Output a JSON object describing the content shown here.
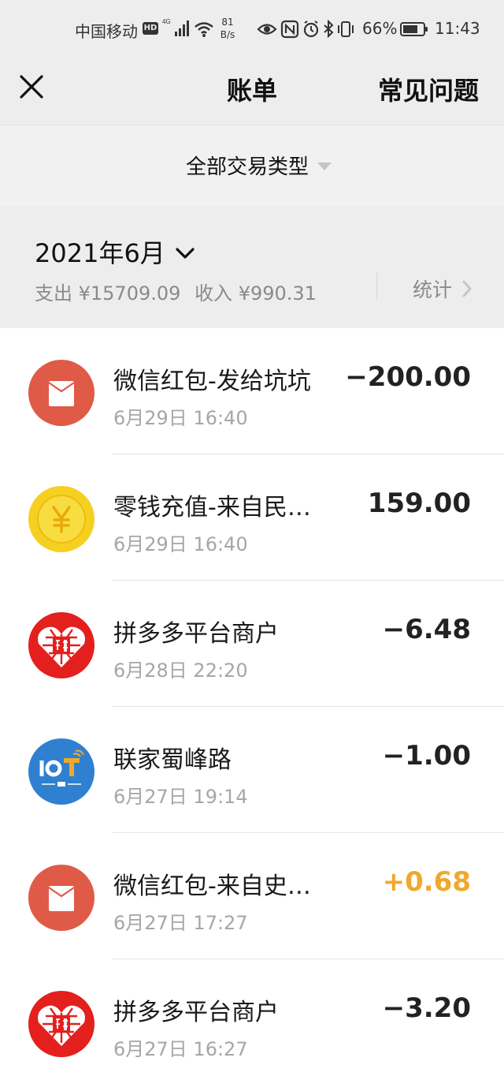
{
  "status_bar": {
    "carrier": "中国移动",
    "hd_badge": "HD",
    "network_type": "4G",
    "speed_value": "81",
    "speed_unit": "B/s",
    "battery_percent": "66%",
    "time": "11:43"
  },
  "nav": {
    "title": "账单",
    "faq_label": "常见问题",
    "close_icon": "close-icon"
  },
  "filter": {
    "label": "全部交易类型"
  },
  "summary": {
    "month": "2021年6月",
    "expense": "支出 ¥15709.09",
    "income": "收入 ¥990.31",
    "stats_label": "统计"
  },
  "colors": {
    "header_bg": "#ededed",
    "income_accent": "#f0a82d",
    "red_packet": "#e05a48",
    "coin": "#f5d020",
    "pinduoduo": "#e3201e",
    "iot_blue": "#2f80d1"
  },
  "transactions": [
    {
      "icon": "red-packet-icon",
      "title": "微信红包-发给坑坑",
      "time": "6月29日 16:40",
      "amount": "−200.00",
      "type": "expense"
    },
    {
      "icon": "yuan-coin-icon",
      "title": "零钱充值-来自民…",
      "time": "6月29日 16:40",
      "amount": "159.00",
      "type": "neutral"
    },
    {
      "icon": "pinduoduo-logo",
      "title": "拼多多平台商户",
      "time": "6月28日 22:20",
      "amount": "−6.48",
      "type": "expense"
    },
    {
      "icon": "iot-logo",
      "title": "联家蜀峰路",
      "time": "6月27日 19:14",
      "amount": "−1.00",
      "type": "expense"
    },
    {
      "icon": "red-packet-icon",
      "title": "微信红包-来自史…",
      "time": "6月27日 17:27",
      "amount": "+0.68",
      "type": "income"
    },
    {
      "icon": "pinduoduo-logo",
      "title": "拼多多平台商户",
      "time": "6月27日 16:27",
      "amount": "−3.20",
      "type": "expense"
    }
  ]
}
